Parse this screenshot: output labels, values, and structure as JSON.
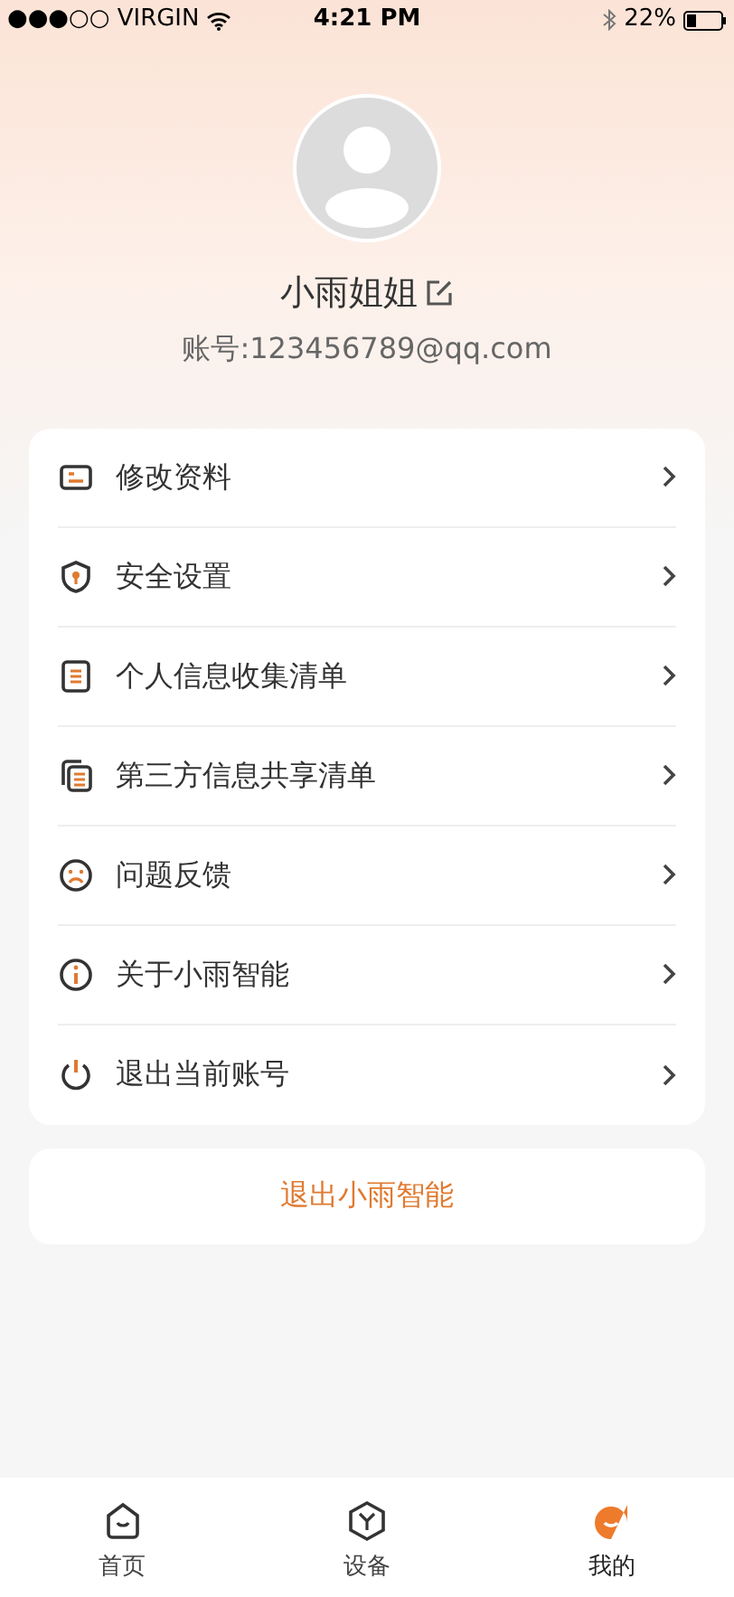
{
  "status_bar": {
    "carrier": "●●●○○ VIRGIN",
    "time": "4:21 PM",
    "battery": "22%"
  },
  "profile": {
    "name": "小雨姐姐",
    "account": "账号:123456789@qq.com"
  },
  "menu": [
    {
      "label": "修改资料"
    },
    {
      "label": "安全设置"
    },
    {
      "label": "个人信息收集清单"
    },
    {
      "label": "第三方信息共享清单"
    },
    {
      "label": "问题反馈"
    },
    {
      "label": "关于小雨智能"
    },
    {
      "label": "退出当前账号"
    }
  ],
  "logout_button": "退出小雨智能",
  "tabs": [
    {
      "label": "首页",
      "selected": false
    },
    {
      "label": "设备",
      "selected": false
    },
    {
      "label": "我的",
      "selected": true
    }
  ]
}
